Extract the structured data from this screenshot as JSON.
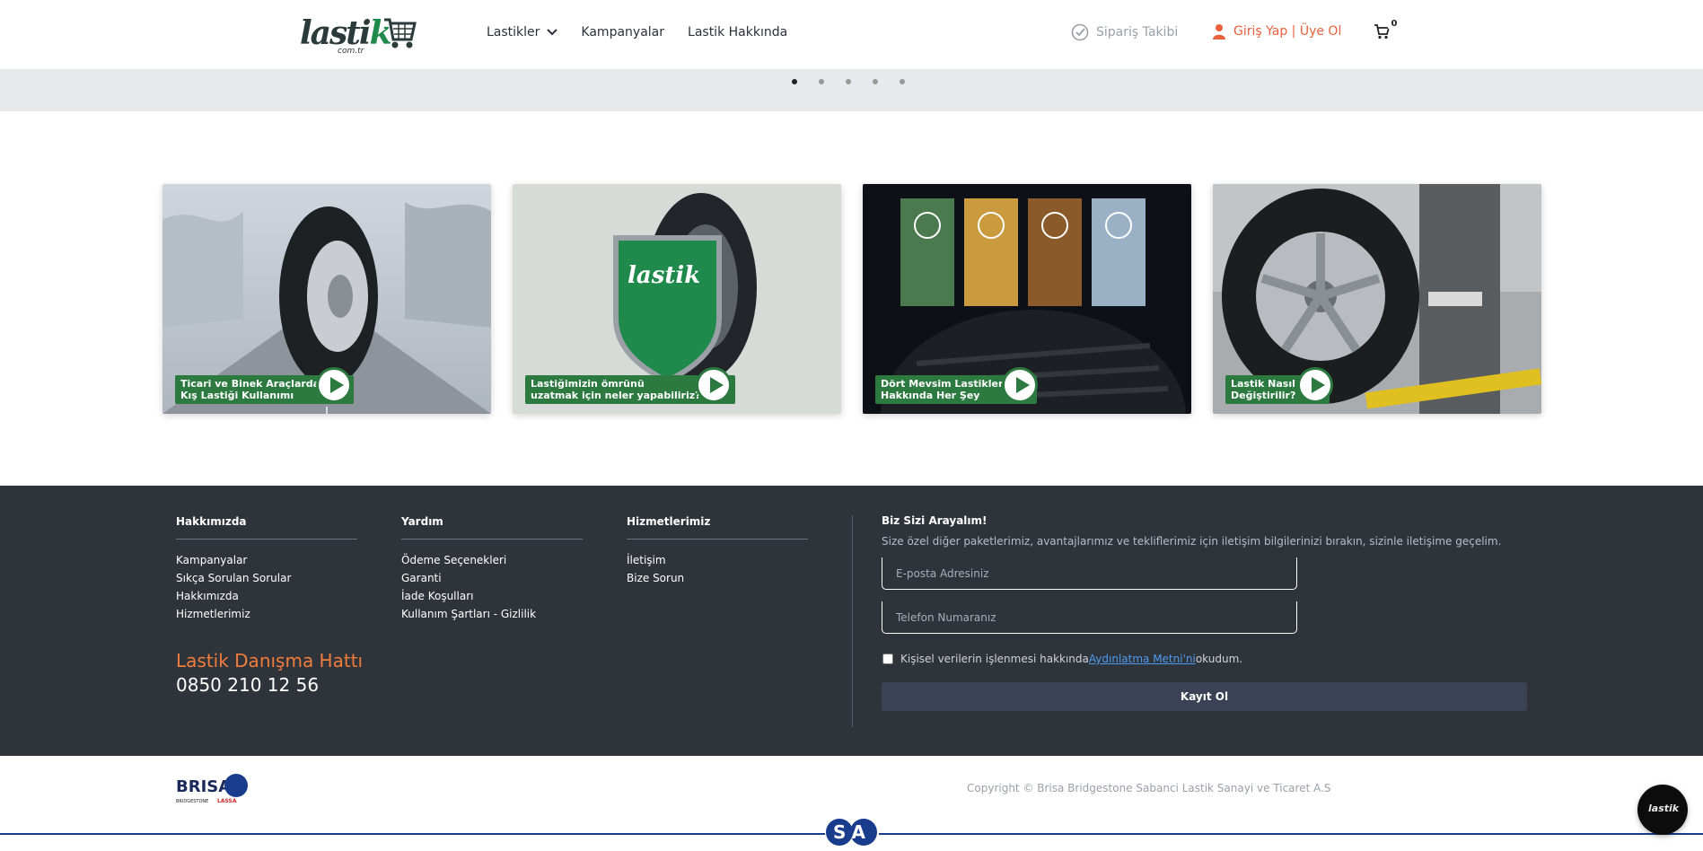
{
  "header": {
    "logo_alt": "lastik com.tr",
    "logo_word": "lasti",
    "logo_word_k": "k",
    "logo_sub": "com.tr",
    "nav": [
      {
        "label": "Lastikler",
        "has_dropdown": true
      },
      {
        "label": "Kampanyalar"
      },
      {
        "label": "Lastik Hakkında"
      }
    ],
    "order_tracking": "Sipariş Takibi",
    "login": "Giriş Yap | Üye Ol",
    "cart_count": "0"
  },
  "carousel": {
    "dot_count": 5,
    "active_index": 0
  },
  "videos": [
    {
      "label": "Ticari ve Binek Araçlarda\nKış Lastiği Kullanımı"
    },
    {
      "label": "Lastiğimizin ömrünü\nuzatmak için neler yapabiliriz?"
    },
    {
      "label": "Dört Mevsim Lastikler\nHakkında Her Şey"
    },
    {
      "label": "Lastik Nasıl\nDeğiştirilir?"
    }
  ],
  "footer": {
    "columns": [
      {
        "title": "Hakkımızda",
        "links": [
          "Kampanyalar",
          "Sıkça Sorulan Sorular",
          "Hakkımızda",
          "Hizmetlerimiz"
        ]
      },
      {
        "title": "Yardım",
        "links": [
          "Ödeme Seçenekleri",
          "Garanti",
          "İade Koşulları",
          "Kullanım Şartları - Gizlilik"
        ]
      },
      {
        "title": "Hizmetlerimiz",
        "links": [
          "İletişim",
          "Bize Sorun"
        ]
      }
    ],
    "hotline_title": "Lastik Danışma Hattı",
    "hotline_number": "0850 210 12 56",
    "subscribe": {
      "title": "Biz Sizi Arayalım!",
      "description": "Size özel diğer paketlerimiz, avantajlarımız ve tekliflerimiz için iletişim bilgilerinizi bırakın, sizinle iletişime geçelim.",
      "email_placeholder": "E-posta Adresiniz",
      "phone_placeholder": "Telefon Numaranız",
      "consent_prefix": "Kişisel verilerin işlenmesi hakkında",
      "consent_link": "Aydınlatma Metni'ni",
      "consent_suffix": "okudum.",
      "button": "Kayıt Ol"
    }
  },
  "bottom": {
    "copyright": "Copyright © Brisa Bridgestone Sabanci Lastik Sanayi ve Ticaret A.S",
    "brand_logo": "BRISA",
    "brand_sub_left": "BRIDGESTONE",
    "brand_sub_right": "LASSA",
    "sa_logo": "SA",
    "chat_logo": "lastik"
  },
  "colors": {
    "accent_orange": "#e8603c",
    "brand_green": "#2c7a3f",
    "footer_bg": "#2f333a",
    "link_blue": "#4d9bef"
  }
}
